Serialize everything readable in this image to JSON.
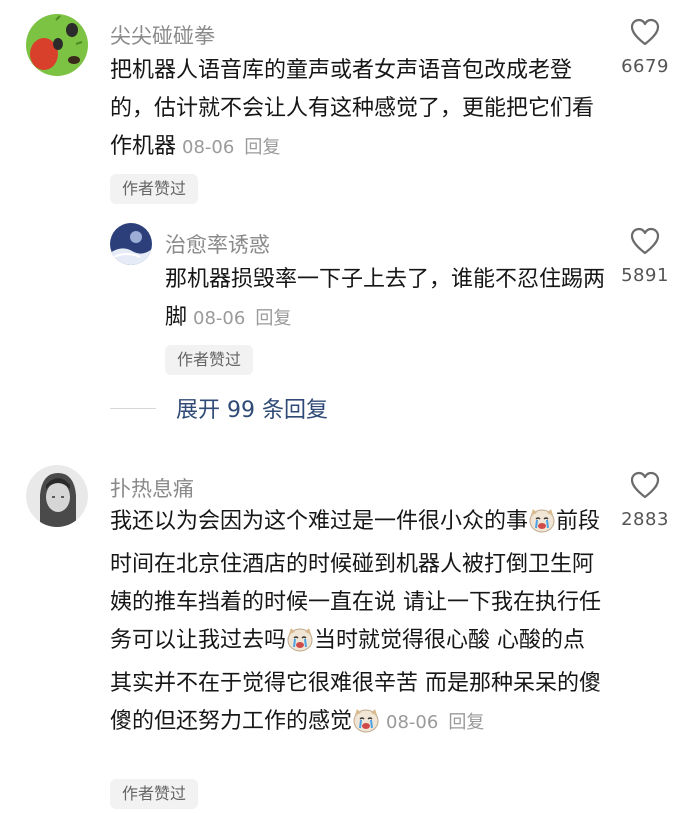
{
  "comments": [
    {
      "username": "尖尖碰碰拳",
      "text": "把机器人语音库的童声或者女声语音包改成老登的，估计就不会让人有这种感觉了，更能把它们看作机器",
      "date": "08-06",
      "reply_label": "回复",
      "badge": "作者赞过",
      "likes": "6679",
      "avatar_icon": "cactus-avatar-icon"
    },
    {
      "username": "治愈率诱惑",
      "text": "那机器损毁率一下子上去了，谁能不忍住踢两脚",
      "date": "08-06",
      "reply_label": "回复",
      "badge": "作者赞过",
      "likes": "5891",
      "avatar_icon": "night-sky-avatar-icon"
    },
    {
      "username": "扑热息痛",
      "text_part1": "我还以为会因为这个难过是一件很小众的事",
      "text_part2": "前段时间在北京住酒店的时候碰到机器人被打倒卫生阿姨的推车挡着的时候一直在说 请让一下我在执行任务可以让我过去吗",
      "text_part3": "当时就觉得很心酸 心酸的点其实并不在于觉得它很难很辛苦 而是那种呆呆的傻傻的但还努力工作的感觉",
      "date": "08-06",
      "reply_label": "回复",
      "badge": "作者赞过",
      "likes": "2883",
      "avatar_icon": "sketch-portrait-avatar-icon",
      "emoji_icon": "crying-dog-emoji-icon"
    }
  ],
  "expand_replies": "展开 99 条回复",
  "colors": {
    "username": "#8a8a8a",
    "body": "#161616",
    "meta": "#9a9a9a",
    "link": "#2f4a76",
    "badge_bg": "#f2f2f2"
  }
}
